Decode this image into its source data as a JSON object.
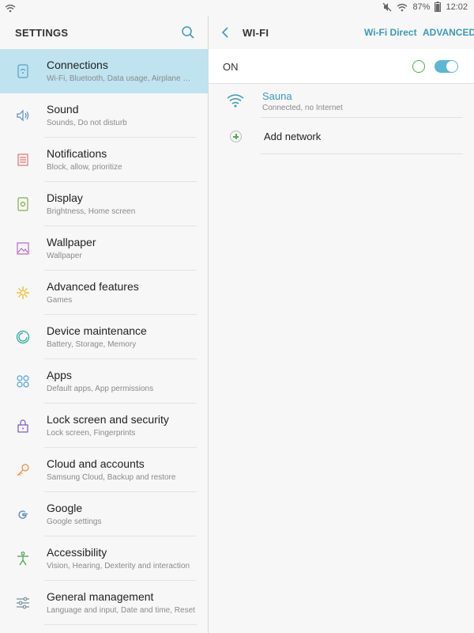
{
  "statusbar": {
    "left_icon": "wifi-icon",
    "battery": "87%",
    "time": "12:02",
    "icons": [
      "mute-icon",
      "wifi-signal-icon",
      "battery-icon"
    ]
  },
  "left": {
    "title": "SETTINGS",
    "search_icon": "search-icon",
    "items": [
      {
        "title": "Connections",
        "subtitle": "Wi-Fi, Bluetooth, Data usage, Airplane mode",
        "icon": "connections-icon",
        "color": "#5a9fc4"
      },
      {
        "title": "Sound",
        "subtitle": "Sounds, Do not disturb",
        "icon": "sound-icon",
        "color": "#5b8fc9"
      },
      {
        "title": "Notifications",
        "subtitle": "Block, allow, prioritize",
        "icon": "notifications-icon",
        "color": "#e57373"
      },
      {
        "title": "Display",
        "subtitle": "Brightness, Home screen",
        "icon": "display-icon",
        "color": "#7cb342"
      },
      {
        "title": "Wallpaper",
        "subtitle": "Wallpaper",
        "icon": "wallpaper-icon",
        "color": "#ba68c8"
      },
      {
        "title": "Advanced features",
        "subtitle": "Games",
        "icon": "advanced-features-icon",
        "color": "#f4b400"
      },
      {
        "title": "Device maintenance",
        "subtitle": "Battery, Storage, Memory",
        "icon": "device-maintenance-icon",
        "color": "#26a69a"
      },
      {
        "title": "Apps",
        "subtitle": "Default apps, App permissions",
        "icon": "apps-icon",
        "color": "#4aa3df"
      },
      {
        "title": "Lock screen and security",
        "subtitle": "Lock screen, Fingerprints",
        "icon": "lock-icon",
        "color": "#7e57c2"
      },
      {
        "title": "Cloud and accounts",
        "subtitle": "Samsung Cloud, Backup and restore",
        "icon": "key-icon",
        "color": "#ef8a3a"
      },
      {
        "title": "Google",
        "subtitle": "Google settings",
        "icon": "google-icon",
        "color": "#5b8fc9"
      },
      {
        "title": "Accessibility",
        "subtitle": "Vision, Hearing, Dexterity and interaction",
        "icon": "accessibility-icon",
        "color": "#43a047"
      },
      {
        "title": "General management",
        "subtitle": "Language and input, Date and time, Reset",
        "icon": "sliders-icon",
        "color": "#78909c"
      }
    ]
  },
  "right": {
    "back_icon": "back-arrow-icon",
    "title": "WI-FI",
    "wifi_direct": "Wi-Fi Direct",
    "advanced": "ADVANCED",
    "on_label": "ON",
    "toggle_on": true,
    "network": {
      "name": "Sauna",
      "status": "Connected, no Internet",
      "icon": "wifi-signal-icon"
    },
    "add_network": "Add network",
    "add_icon": "plus-icon"
  },
  "colors": {
    "accent": "#3b9ab8",
    "active_bg": "#bfe3ef",
    "toggle": "#5bb7d5",
    "green": "#4caf50"
  }
}
